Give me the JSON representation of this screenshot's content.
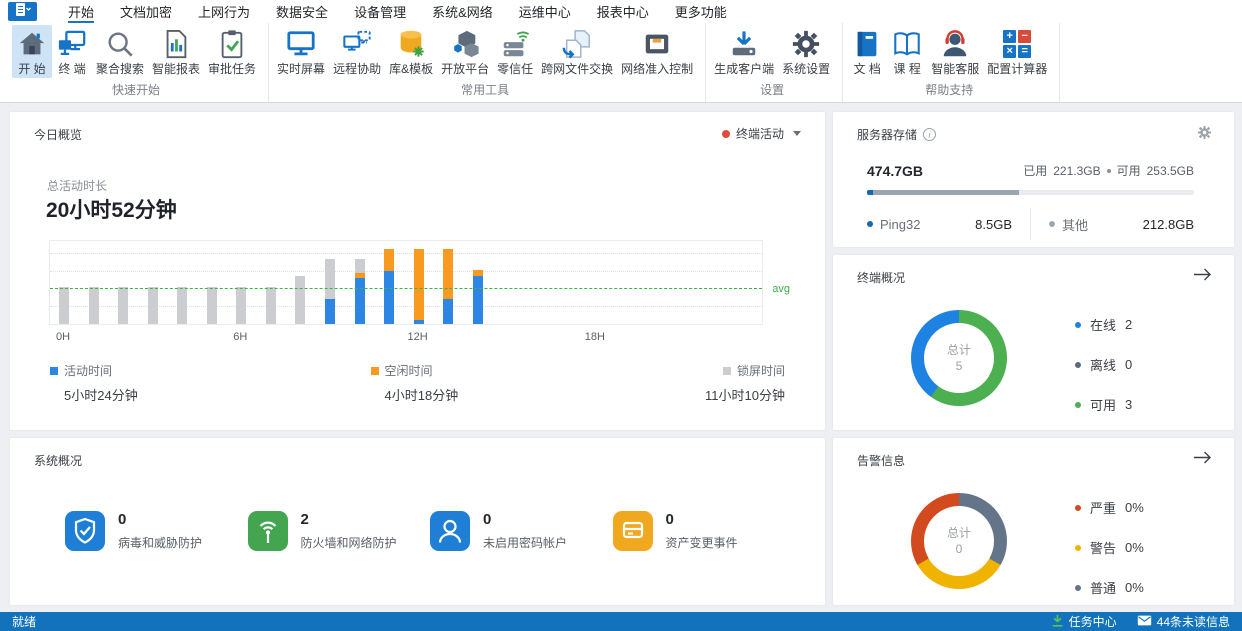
{
  "menu": {
    "items": [
      {
        "label": "开始",
        "active": true
      },
      {
        "label": "文档加密",
        "active": false
      },
      {
        "label": "上网行为",
        "active": false
      },
      {
        "label": "数据安全",
        "active": false
      },
      {
        "label": "设备管理",
        "active": false
      },
      {
        "label": "系统&网络",
        "active": false
      },
      {
        "label": "运维中心",
        "active": false
      },
      {
        "label": "报表中心",
        "active": false
      },
      {
        "label": "更多功能",
        "active": false
      }
    ]
  },
  "ribbon": {
    "groups": [
      {
        "label": "快速开始",
        "items": [
          {
            "label": "开 始",
            "icon": "home",
            "selected": true
          },
          {
            "label": "终 端",
            "icon": "terminals"
          },
          {
            "label": "聚合搜索",
            "icon": "search"
          },
          {
            "label": "智能报表",
            "icon": "report"
          },
          {
            "label": "审批任务",
            "icon": "tasks"
          }
        ]
      },
      {
        "label": "常用工具",
        "items": [
          {
            "label": "实时屏幕",
            "icon": "screen"
          },
          {
            "label": "远程协助",
            "icon": "remote"
          },
          {
            "label": "库&模板",
            "icon": "library"
          },
          {
            "label": "开放平台",
            "icon": "platform"
          },
          {
            "label": "零信任",
            "icon": "zerotrust"
          },
          {
            "label": "跨网文件交换",
            "icon": "exchange"
          },
          {
            "label": "网络准入控制",
            "icon": "nac"
          }
        ]
      },
      {
        "label": "设置",
        "items": [
          {
            "label": "生成客户端",
            "icon": "client"
          },
          {
            "label": "系统设置",
            "icon": "gear"
          }
        ]
      },
      {
        "label": "帮助支持",
        "items": [
          {
            "label": "文 档",
            "icon": "doc"
          },
          {
            "label": "课 程",
            "icon": "course"
          },
          {
            "label": "智能客服",
            "icon": "service"
          },
          {
            "label": "配置计算器",
            "icon": "calculator"
          }
        ]
      }
    ]
  },
  "today": {
    "title": "今日概览",
    "filter": {
      "label": "终端活动",
      "dot_color": "#E04B3A"
    },
    "total_label": "总活动时长",
    "total_value": "20小时52分钟",
    "legend": [
      {
        "label": "活动时间",
        "value": "5小时24分钟",
        "color": "#2E86E4"
      },
      {
        "label": "空闲时间",
        "value": "4小时18分钟",
        "color": "#F79A1F"
      },
      {
        "label": "锁屏时间",
        "value": "11小时10分钟",
        "color": "#CBCDD0"
      }
    ]
  },
  "chart_data": [
    {
      "id": "today-activity",
      "type": "bar",
      "stacked": true,
      "title": "今日概览 · 终端活动(按小时)",
      "x_unit": "hour of day",
      "x_ticks": [
        {
          "hour": 0,
          "label": "0H"
        },
        {
          "hour": 6,
          "label": "6H"
        },
        {
          "hour": 12,
          "label": "12H"
        },
        {
          "hour": 18,
          "label": "18H"
        }
      ],
      "y_axis": "unlabeled, values are estimated fractions of plot height",
      "avg_line_fraction": 0.42,
      "avg_label": "avg",
      "avg_color": "#3CB44A",
      "series": [
        {
          "name": "活动时间",
          "color": "#2E86E4",
          "values_by_hour": {
            "9": 0.3,
            "10": 0.55,
            "11": 0.64,
            "12": 0.05,
            "13": 0.3,
            "14": 0.58
          }
        },
        {
          "name": "空闲时间",
          "color": "#F79A1F",
          "values_by_hour": {
            "10": 0.07,
            "11": 0.26,
            "12": 0.85,
            "13": 0.6,
            "14": 0.07
          }
        },
        {
          "name": "锁屏时间",
          "color": "#CBCDD0",
          "values_by_hour": {
            "0": 0.45,
            "1": 0.45,
            "2": 0.45,
            "3": 0.45,
            "4": 0.45,
            "5": 0.45,
            "6": 0.45,
            "7": 0.45,
            "8": 0.58,
            "9": 0.48,
            "10": 0.16
          }
        }
      ]
    },
    {
      "id": "terminal-overview",
      "type": "pie",
      "donut": true,
      "center_label": "总计",
      "center_value": "5",
      "segments": [
        {
          "label": "可用",
          "value": 3,
          "color": "#4CAF50"
        },
        {
          "label": "在线",
          "value": 2,
          "color": "#1E82E2"
        },
        {
          "label": "离线",
          "value": 0,
          "color": "#5A6B7D"
        }
      ]
    },
    {
      "id": "alarm-info",
      "type": "pie",
      "donut": true,
      "center_label": "总计",
      "center_value": "0",
      "note": "total 0 rendered as equal thirds",
      "segments": [
        {
          "label": "普通",
          "fraction": 0.3333,
          "color": "#64758A"
        },
        {
          "label": "警告",
          "fraction": 0.3333,
          "color": "#F0B400"
        },
        {
          "label": "严重",
          "fraction": 0.3334,
          "color": "#D34A1E"
        }
      ]
    }
  ],
  "storage": {
    "title": "服务器存储",
    "total": "474.7GB",
    "total_gb": 474.7,
    "used_label": "已用",
    "used_value": "221.3GB",
    "free_label": "可用",
    "free_value": "253.5GB",
    "track_color": "#E9EBEE",
    "bar_segments": [
      {
        "label": "Ping32",
        "gb": 8.5,
        "color": "#1767B3"
      },
      {
        "label": "其他",
        "gb": 212.8,
        "color": "#9AA6B2"
      }
    ],
    "legend": [
      {
        "label": "Ping32",
        "value": "8.5GB",
        "dot": "#1767B3"
      },
      {
        "label": "其他",
        "value": "212.8GB",
        "dot": "#9AA6B2"
      }
    ]
  },
  "terminal": {
    "title": "终端概况",
    "legend": [
      {
        "label": "在线",
        "value": "2",
        "dot": "#1E82E2"
      },
      {
        "label": "离线",
        "value": "0",
        "dot": "#5A6B7D"
      },
      {
        "label": "可用",
        "value": "3",
        "dot": "#4CAF50"
      }
    ]
  },
  "alarm": {
    "title": "告警信息",
    "legend": [
      {
        "label": "严重",
        "value": "0%",
        "dot": "#D34A1E"
      },
      {
        "label": "警告",
        "value": "0%",
        "dot": "#F0B400"
      },
      {
        "label": "普通",
        "value": "0%",
        "dot": "#64758A"
      }
    ]
  },
  "system": {
    "title": "系统概况",
    "items": [
      {
        "count": "0",
        "label": "病毒和威胁防护",
        "icon": "sys-shield",
        "color": "#1F7FD6"
      },
      {
        "count": "2",
        "label": "防火墙和网络防护",
        "icon": "sys-signal",
        "color": "#43A550"
      },
      {
        "count": "0",
        "label": "未启用密码帐户",
        "icon": "sys-user",
        "color": "#1F7FD6"
      },
      {
        "count": "0",
        "label": "资产变更事件",
        "icon": "sys-asset",
        "color": "#F0A81F"
      }
    ]
  },
  "statusbar": {
    "ready": "就绪",
    "task_center": "任务中心",
    "unread": "44条未读信息"
  }
}
